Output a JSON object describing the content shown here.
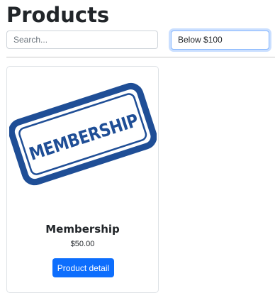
{
  "page": {
    "title": "Products"
  },
  "filters": {
    "search_placeholder": "Search...",
    "search_value": "",
    "price_filter_value": "Below $100"
  },
  "products": [
    {
      "image_text": "MEMBERSHIP",
      "name": "Membership",
      "price": "$50.00",
      "button_label": "Product detail"
    }
  ],
  "colors": {
    "primary": "#0d6efd",
    "stamp_blue": "#1f4e96",
    "text": "#212529"
  }
}
